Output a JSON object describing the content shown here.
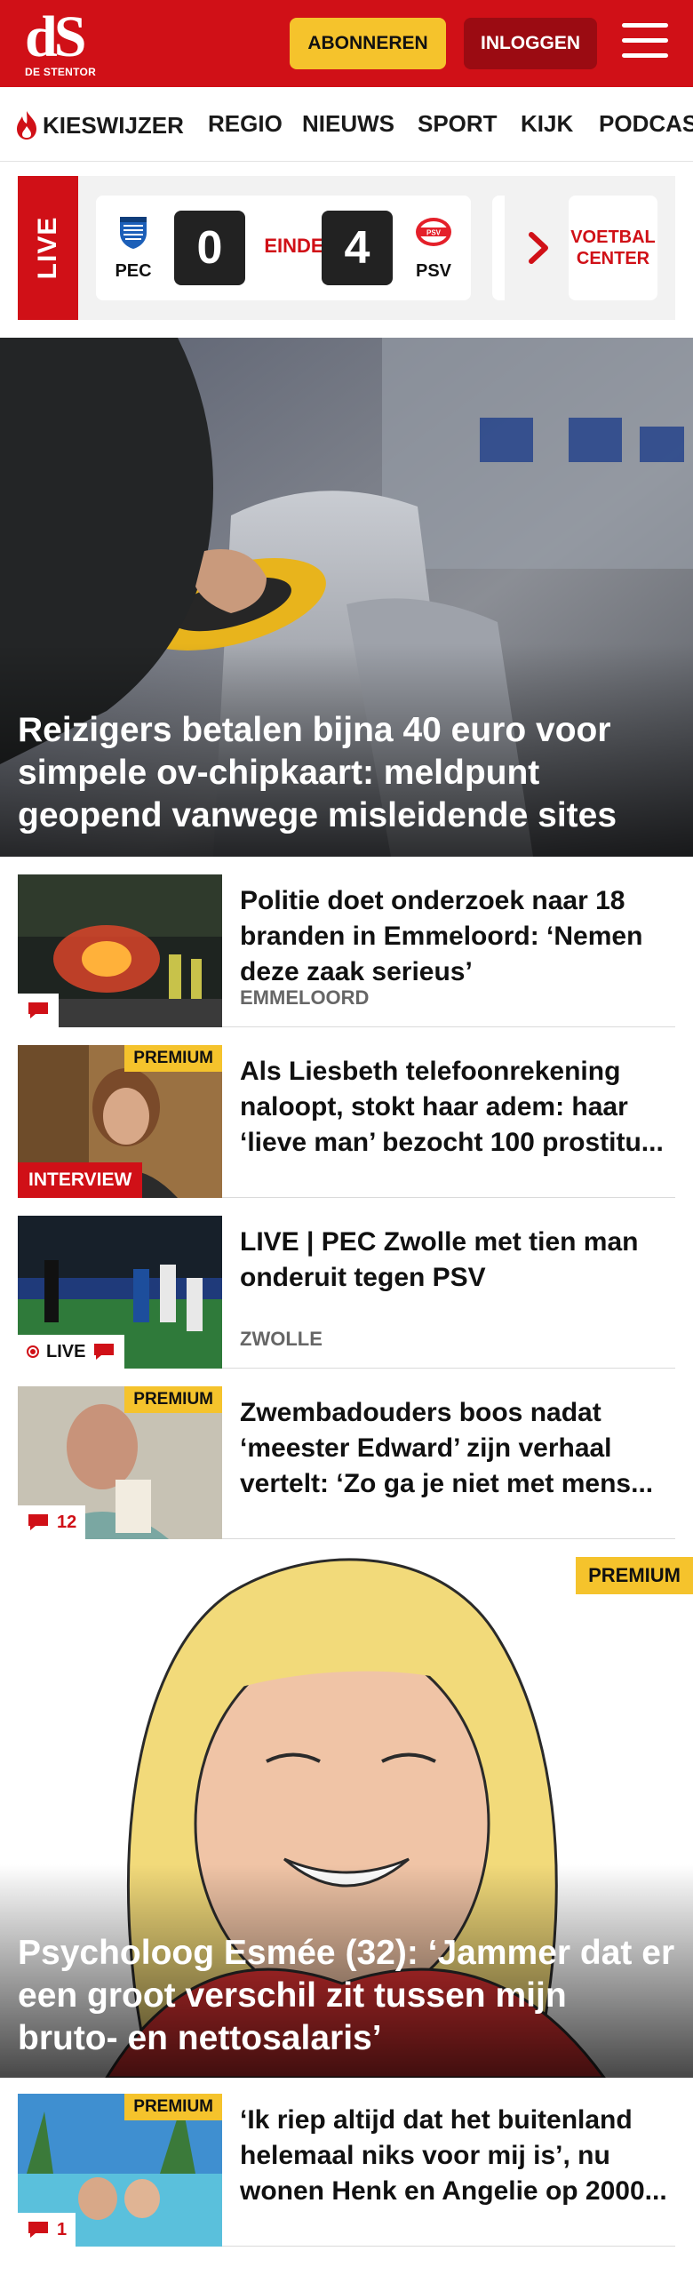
{
  "header": {
    "logo_mark": "dS",
    "logo_sub": "DE STENTOR",
    "subscribe_label": "ABONNEREN",
    "login_label": "INLOGGEN",
    "brand_color": "#d01017"
  },
  "nav": {
    "items": [
      "KIESWIJZER",
      "REGIO",
      "NIEUWS",
      "SPORT",
      "KIJK",
      "PODCAST"
    ]
  },
  "live": {
    "tag": "LIVE",
    "home_team": "PEC",
    "away_team": "PSV",
    "home_score": "0",
    "away_score": "4",
    "status": "EINDE",
    "voetbal_center": "VOETBAL CENTER"
  },
  "hero": {
    "title": "Reizigers betalen bijna 40 euro voor simpele ov-chipkaart: meldpunt geopend vanwege misleidende sites"
  },
  "articles": [
    {
      "title": "Politie doet onderzoek naar 18 branden in Emmeloord: ‘Nemen deze zaak serieus’",
      "location": "EMMELOORD",
      "comments": ""
    },
    {
      "title": "Als Liesbeth telefoonrekening naloopt, stokt haar adem: haar ‘lieve man’ bezocht 100 prostitu...",
      "premium": "PREMIUM",
      "tag": "INTERVIEW"
    },
    {
      "title": "LIVE | PEC Zwolle met tien man onderuit tegen PSV",
      "location": "ZWOLLE",
      "live": "LIVE"
    },
    {
      "title": "Zwembadouders boos nadat ‘meester Edward’ zijn verhaal vertelt: ‘Zo ga je niet met mens...",
      "premium": "PREMIUM",
      "comments": "12"
    }
  ],
  "big": {
    "premium": "PREMIUM",
    "title": "Psycholoog Esmée (32): ‘Jammer dat er een groot verschil zit tussen mijn bruto- en nettosalaris’"
  },
  "last_article": {
    "title": "‘Ik riep altijd dat het buitenland helemaal niks voor mij is’, nu wonen Henk en Angelie op 2000...",
    "premium": "PREMIUM",
    "comments": "1"
  }
}
